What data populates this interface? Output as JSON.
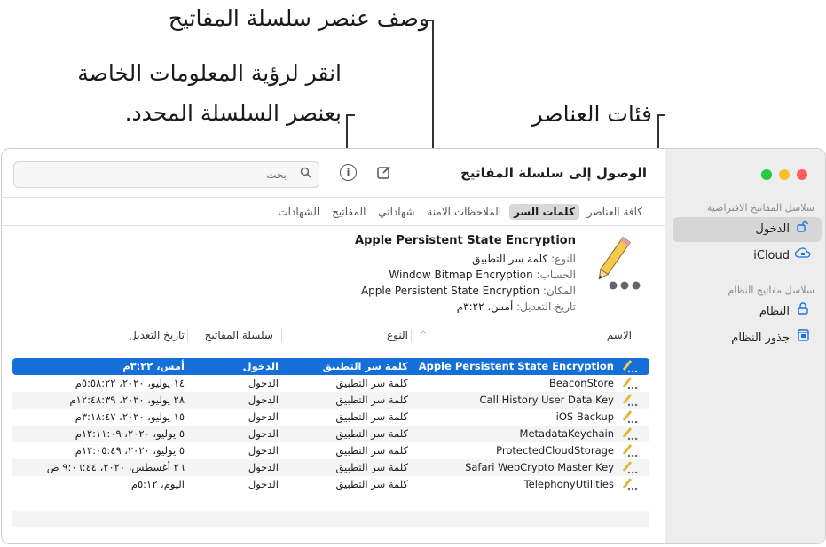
{
  "callouts": {
    "description": "وصف عنصر سلسلة المفاتيح",
    "info_line1": "انقر لرؤية المعلومات الخاصة",
    "info_line2": "بعنصر السلسلة المحدد.",
    "categories": "فئات العناصر"
  },
  "window": {
    "title": "الوصول إلى سلسلة المفاتيح",
    "search_placeholder": "بحث",
    "icons": {
      "info": "info-icon",
      "new_item": "compose-icon",
      "search": "search-icon"
    }
  },
  "sidebar": {
    "default_header": "سلاسل المفاتيح الافتراضية",
    "system_header": "سلاسل مفاتيح النظام",
    "items": [
      {
        "label": "الدخول",
        "icon": "open-lock-icon",
        "selected": true
      },
      {
        "label": "iCloud",
        "icon": "cloud-lock-icon",
        "selected": false
      },
      {
        "label": "النظام",
        "icon": "lock-icon",
        "selected": false
      },
      {
        "label": "جذور النظام",
        "icon": "cabinet-icon",
        "selected": false
      }
    ]
  },
  "tabs": [
    {
      "label": "كافة العناصر",
      "active": false
    },
    {
      "label": "كلمات السر",
      "active": true
    },
    {
      "label": "الملاحظات الآمنة",
      "active": false
    },
    {
      "label": "شهاداتي",
      "active": false
    },
    {
      "label": "المفاتيح",
      "active": false
    },
    {
      "label": "الشهادات",
      "active": false
    }
  ],
  "detail": {
    "title": "Apple Persistent State Encryption",
    "kind_label": "النوع:",
    "kind_value": "كلمة سر التطبيق",
    "account_label": "الحساب:",
    "account_value": "Window Bitmap Encryption",
    "where_label": "المكان:",
    "where_value": "Apple Persistent State Encryption",
    "modified_label": "تاريخ التعديل:",
    "modified_value": "أمس، ٣:٢٢م"
  },
  "table": {
    "columns": {
      "name": "الاسم",
      "kind": "النوع",
      "keychain": "سلسلة المفاتيح",
      "modified": "تاريخ التعديل"
    },
    "sort_indicator": "⌃",
    "rows": [
      {
        "name": "Apple Persistent State Encryption",
        "kind": "كلمة سر التطبيق",
        "keychain": "الدخول",
        "modified": "أمس، ٣:٢٢م",
        "selected": true
      },
      {
        "name": "BeaconStore",
        "kind": "كلمة سر التطبيق",
        "keychain": "الدخول",
        "modified": "١٤ يوليو، ٢٠٢٠، ٥:٥٨:٢٢م",
        "selected": false
      },
      {
        "name": "Call History User Data Key",
        "kind": "كلمة سر التطبيق",
        "keychain": "الدخول",
        "modified": "٢٨ يوليو، ٢٠٢٠، ١٢:٤٨:٣٩م",
        "selected": false
      },
      {
        "name": "iOS Backup",
        "kind": "كلمة سر التطبيق",
        "keychain": "الدخول",
        "modified": "١٥ يوليو، ٢٠٢٠، ٣:١٨:٤٧م",
        "selected": false
      },
      {
        "name": "MetadataKeychain",
        "kind": "كلمة سر التطبيق",
        "keychain": "الدخول",
        "modified": "٥ يوليو، ٢٠٢٠، ١٢:١١:٠٩م",
        "selected": false
      },
      {
        "name": "ProtectedCloudStorage",
        "kind": "كلمة سر التطبيق",
        "keychain": "الدخول",
        "modified": "٥ يوليو، ٢٠٢٠، ١٢:٠٥:٤٩م",
        "selected": false
      },
      {
        "name": "Safari WebCrypto Master Key",
        "kind": "كلمة سر التطبيق",
        "keychain": "الدخول",
        "modified": "٢٦ أغسطس، ٢٠٢٠، ٩:٠٦:٤٤ ص",
        "selected": false
      },
      {
        "name": "TelephonyUtilities",
        "kind": "كلمة سر التطبيق",
        "keychain": "الدخول",
        "modified": "اليوم، ٥:١٢م",
        "selected": false
      }
    ]
  },
  "colors": {
    "accent": "#1470d8",
    "close": "#ff5f57",
    "minimize": "#febc2e",
    "zoom": "#28c840",
    "sidebar_icon": "#1a73e8"
  }
}
